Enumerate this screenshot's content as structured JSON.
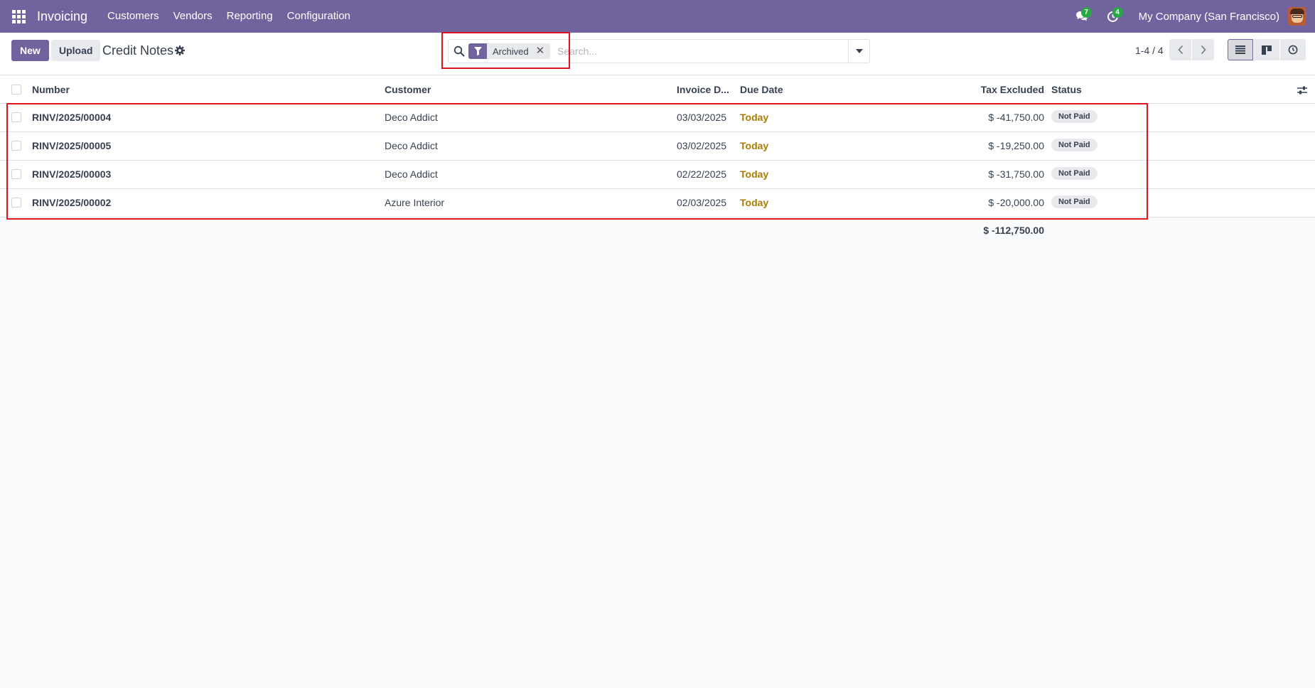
{
  "navbar": {
    "app_name": "Invoicing",
    "menu": [
      "Customers",
      "Vendors",
      "Reporting",
      "Configuration"
    ],
    "messages_count": "7",
    "activities_count": "4",
    "company": "My Company (San Francisco)"
  },
  "control_panel": {
    "new_label": "New",
    "upload_label": "Upload",
    "title": "Credit Notes",
    "search": {
      "facet_label": "Archived",
      "facet_remove": "✕",
      "placeholder": "Search..."
    },
    "pager": "1-4 / 4"
  },
  "list": {
    "columns": {
      "number": "Number",
      "customer": "Customer",
      "invoice_date": "Invoice D...",
      "due_date": "Due Date",
      "tax_excluded": "Tax Excluded",
      "status": "Status"
    },
    "rows": [
      {
        "number": "RINV/2025/00004",
        "customer": "Deco Addict",
        "invoice_date": "03/03/2025",
        "due_date": "Today",
        "tax_excluded": "$ -41,750.00",
        "status": "Not Paid"
      },
      {
        "number": "RINV/2025/00005",
        "customer": "Deco Addict",
        "invoice_date": "03/02/2025",
        "due_date": "Today",
        "tax_excluded": "$ -19,250.00",
        "status": "Not Paid"
      },
      {
        "number": "RINV/2025/00003",
        "customer": "Deco Addict",
        "invoice_date": "02/22/2025",
        "due_date": "Today",
        "tax_excluded": "$ -31,750.00",
        "status": "Not Paid"
      },
      {
        "number": "RINV/2025/00002",
        "customer": "Azure Interior",
        "invoice_date": "02/03/2025",
        "due_date": "Today",
        "tax_excluded": "$ -20,000.00",
        "status": "Not Paid"
      }
    ],
    "total": "$ -112,750.00"
  },
  "colors": {
    "brand": "#71639e",
    "due_today": "#a87b07",
    "highlight": "#e0141e",
    "badge_green": "#28a745"
  },
  "icons": [
    "apps-icon",
    "chat-icon",
    "clock-icon",
    "gear-icon",
    "search-icon",
    "filter-icon",
    "chevron-left-icon",
    "chevron-right-icon",
    "list-view-icon",
    "kanban-view-icon",
    "activity-view-icon",
    "optional-columns-icon"
  ]
}
